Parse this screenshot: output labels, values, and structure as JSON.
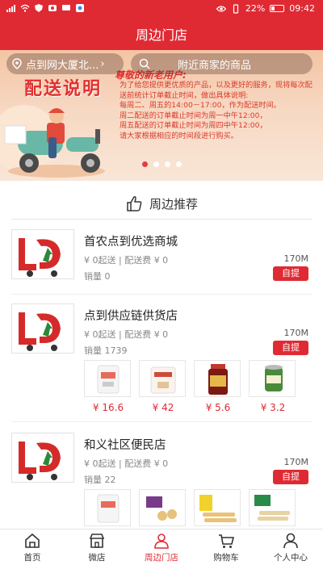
{
  "status_bar": {
    "battery": "22%",
    "time": "09:42"
  },
  "header": {
    "title": "周边门店"
  },
  "banner": {
    "location": "点到网大厦北...",
    "search_placeholder": "附近商家的商品",
    "heading": "配送说明",
    "greeting": "尊敬的新老用户:",
    "body": "为了给您提供更优质的产品，以及更好的服务，现将每次配送前统计订单截止时间，做出具体说明:\n每周二、周五的14:00－17:00，作为配送时间。\n周二配送的订单截止时间为周一中午12:00，\n周五配送的订单截止时间为周四中午12:00，\n请大家根据相应的时间段进行购买。",
    "dots": 4,
    "active_dot": 0
  },
  "section": {
    "title": "周边推荐"
  },
  "shops": [
    {
      "name": "首农点到优选商城",
      "meta": "¥ 0起送  |  配送费 ¥ 0",
      "distance": "170M",
      "sales": "销量 0",
      "tag": "自提",
      "products": []
    },
    {
      "name": "点到供应链供货店",
      "meta": "¥ 0起送  |  配送费 ¥ 0",
      "distance": "170M",
      "sales": "销量 1739",
      "tag": "自提",
      "products": [
        {
          "price": "¥ 16.6"
        },
        {
          "price": "¥ 42"
        },
        {
          "price": "¥ 5.6"
        },
        {
          "price": "¥ 3.2"
        }
      ]
    },
    {
      "name": "和义社区便民店",
      "meta": "¥ 0起送  |  配送费 ¥ 0",
      "distance": "170M",
      "sales": "销量 22",
      "tag": "自提",
      "products": [
        {
          "price": ""
        },
        {
          "price": ""
        },
        {
          "price": ""
        },
        {
          "price": ""
        }
      ]
    }
  ],
  "tabs": [
    {
      "label": "首页",
      "icon": "home-icon"
    },
    {
      "label": "微店",
      "icon": "store-icon"
    },
    {
      "label": "周边门店",
      "icon": "nearby-shops-icon",
      "active": true
    },
    {
      "label": "购物车",
      "icon": "cart-icon"
    },
    {
      "label": "个人中心",
      "icon": "user-icon"
    }
  ],
  "colors": {
    "brand_red": "#e02a33"
  }
}
